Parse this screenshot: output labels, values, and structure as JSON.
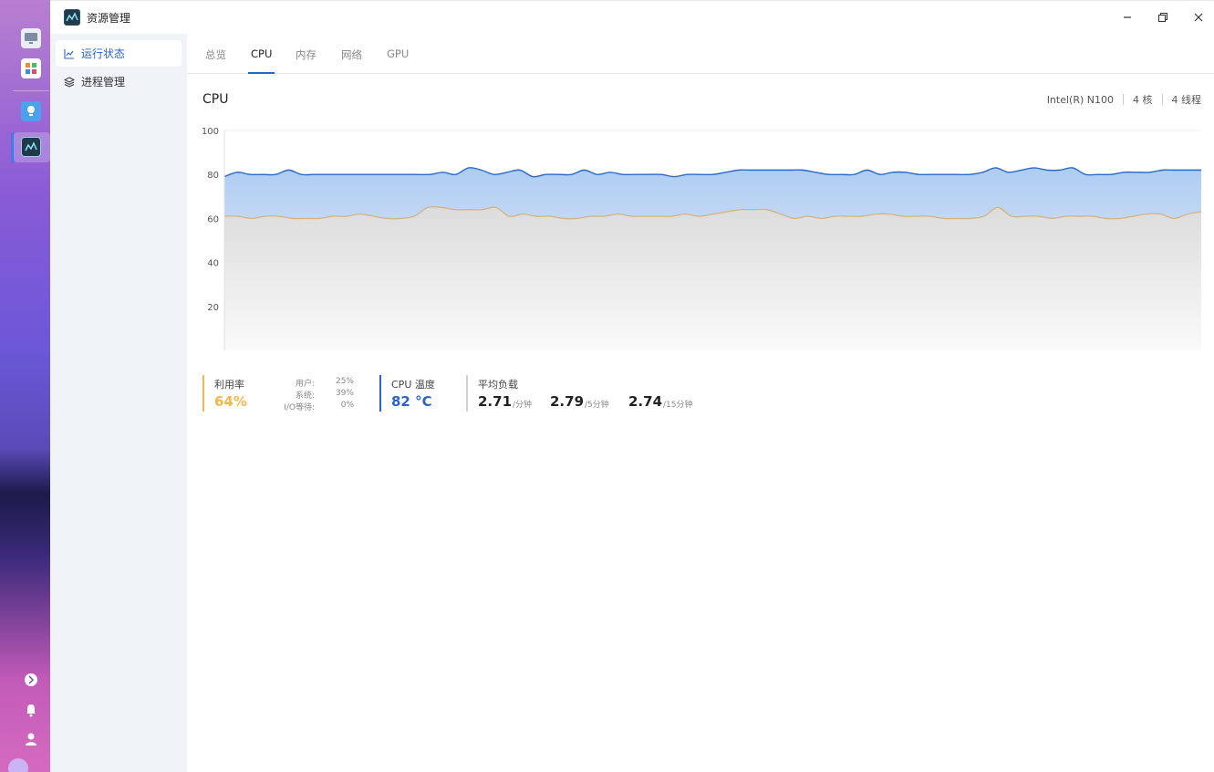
{
  "window": {
    "title": "资源管理"
  },
  "sidebar": {
    "items": [
      {
        "label": "运行状态",
        "icon": "line-chart-icon",
        "active": true
      },
      {
        "label": "进程管理",
        "icon": "layers-icon",
        "active": false
      }
    ]
  },
  "tabs": [
    {
      "label": "总览",
      "active": false
    },
    {
      "label": "CPU",
      "active": true
    },
    {
      "label": "内存",
      "active": false
    },
    {
      "label": "网络",
      "active": false
    },
    {
      "label": "GPU",
      "active": false
    }
  ],
  "cpu": {
    "title": "CPU",
    "model": "Intel(R) N100",
    "cores": "4 核",
    "threads": "4 线程"
  },
  "chart_data": {
    "type": "area",
    "ylim": [
      0,
      100
    ],
    "yticks": [
      "100",
      "80",
      "60",
      "40",
      "20"
    ],
    "grid": true,
    "series": [
      {
        "color": "#2a6ac8",
        "fill": "#b9d3f3",
        "values": [
          79,
          81,
          80,
          80,
          80,
          82,
          80,
          80,
          80,
          80,
          80,
          80,
          80,
          80,
          80,
          80,
          80,
          81,
          80,
          83,
          82,
          80,
          81,
          82,
          79,
          80,
          80,
          80,
          82,
          80,
          81,
          80,
          80,
          80,
          80,
          79,
          80,
          80,
          80,
          81,
          82,
          82,
          82,
          82,
          82,
          82,
          81,
          80,
          80,
          80,
          82,
          80,
          81,
          81,
          80,
          80,
          80,
          80,
          80,
          81,
          83,
          81,
          82,
          83,
          82,
          82,
          83,
          80,
          80,
          80,
          81,
          81,
          81,
          82,
          82,
          82,
          82
        ]
      },
      {
        "color": "#d4b07a",
        "fill": "#e6e6e6",
        "values": [
          61,
          61,
          60,
          61,
          61,
          60,
          60,
          60,
          61,
          61,
          62,
          61,
          60,
          60,
          61,
          65,
          65,
          64,
          64,
          64,
          65,
          61,
          62,
          61,
          61,
          60,
          60,
          61,
          61,
          62,
          61,
          61,
          61,
          61,
          62,
          61,
          62,
          63,
          64,
          64,
          64,
          62,
          60,
          61,
          60,
          61,
          61,
          61,
          62,
          62,
          61,
          61,
          61,
          60,
          60,
          60,
          61,
          65,
          61,
          61,
          61,
          60,
          61,
          61,
          61,
          60,
          60,
          61,
          62,
          62,
          60,
          62,
          63
        ]
      }
    ]
  },
  "stats": {
    "usage": {
      "label": "利用率",
      "value": "64%",
      "color": "#f2b84b",
      "user_label": "用户:",
      "user_value": "25%",
      "sys_label": "系统:",
      "sys_value": "39%",
      "io_label": "I/O等待:",
      "io_value": "0%"
    },
    "temp": {
      "label": "CPU 温度",
      "value": "82 °C",
      "color": "#2a64c5"
    },
    "load": {
      "label": "平均负载",
      "v1": "2.71",
      "u1": "/分钟",
      "v5": "2.79",
      "u5": "/5分钟",
      "v15": "2.74",
      "u15": "/15分钟"
    }
  }
}
